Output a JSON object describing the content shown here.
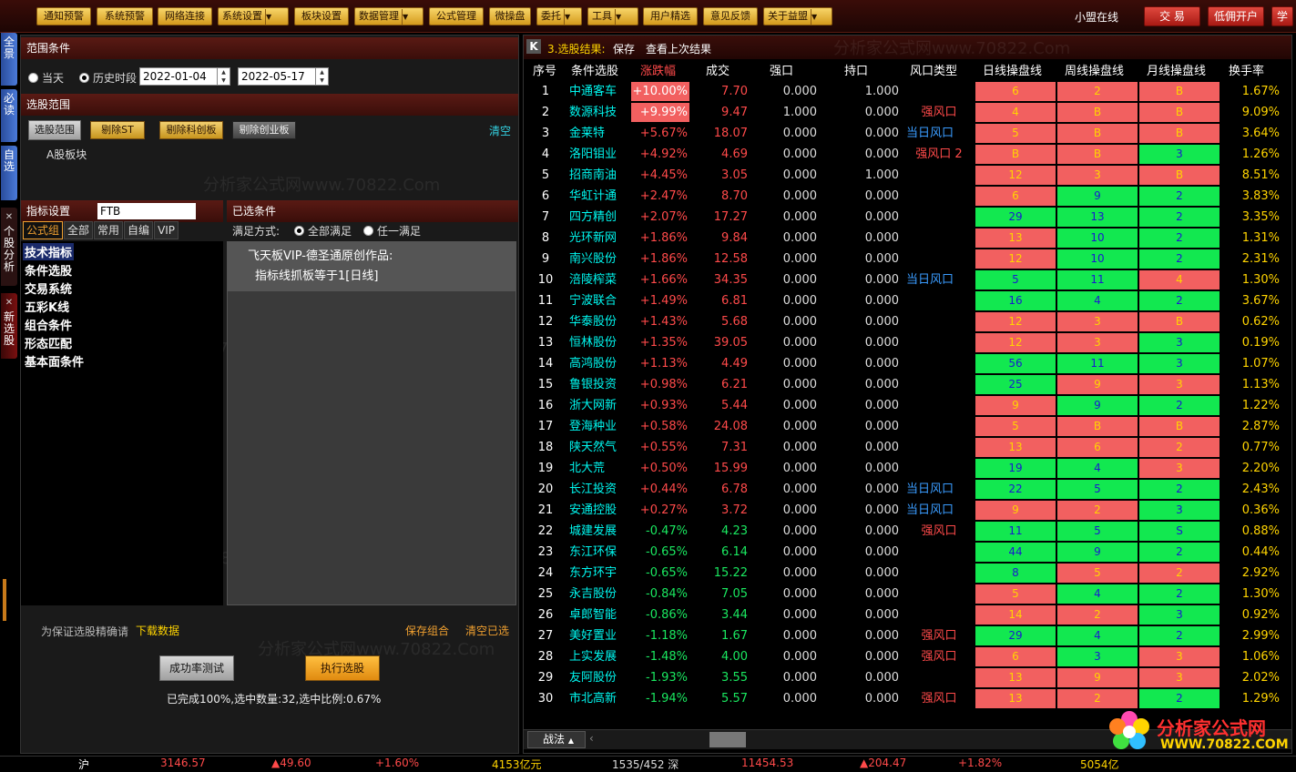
{
  "toolbar": {
    "buttons": [
      "通知预警",
      "系统预警",
      "网络连接",
      "系统设置",
      "板块设置",
      "数据管理",
      "公式管理",
      "微操盘",
      "委托",
      "工具",
      "用户精选",
      "意见反馈",
      "关于益盟"
    ],
    "user_status": "小盟在线",
    "trade_label": "交 易",
    "low_commission_label": "低佣开户",
    "learn_label": "学"
  },
  "side_tabs": [
    "全景",
    "必读",
    "自选",
    "个股分析",
    "新选股"
  ],
  "range": {
    "header": "范围条件",
    "today_label": "当天",
    "history_label": "历史时段",
    "start_date": "2022-01-04",
    "end_date": "2022-05-17"
  },
  "scope": {
    "header": "选股范围",
    "select_scope_btn": "选股范围",
    "remove_st_btn": "剔除ST",
    "remove_star_btn": "剔除科创板",
    "remove_gem_btn": "剔除创业板",
    "clear_link": "清空",
    "block_label": "A股板块"
  },
  "indicator": {
    "header": "指标设置",
    "input_value": "FTB",
    "tabs": [
      "公式组",
      "全部",
      "常用",
      "自编",
      "VIP"
    ],
    "tree_items": [
      "技术指标",
      "条件选股",
      "交易系统",
      "五彩K线",
      "组合条件",
      "形态匹配",
      "基本面条件"
    ]
  },
  "selected": {
    "header": "已选条件",
    "mode_label": "满足方式:",
    "all_label": "全部满足",
    "any_label": "任一满足",
    "line1": "飞天板VIP-德圣通原创作品:",
    "line2": "指标线抓板等于1[日线]"
  },
  "bottom": {
    "notice": "为保证选股精确请",
    "download_link": "下载数据",
    "save_link": "保存组合",
    "clear_selected_link": "清空已选",
    "test_btn": "成功率测试",
    "run_btn": "执行选股",
    "result_text": "已完成100%,选中数量:32,选中比例:0.67%"
  },
  "results": {
    "title": "3.选股结果:",
    "save": "保存",
    "view_last": "查看上次结果",
    "columns": [
      "序号",
      "条件选股",
      "涨跌幅",
      "成交",
      "强口",
      "持口",
      "风口类型",
      "日线操盘线",
      "周线操盘线",
      "月线操盘线",
      "换手率"
    ],
    "rows": [
      {
        "no": "1",
        "name": "中通客车",
        "chg": "+10.00%",
        "vol": "7.70",
        "q": "0.000",
        "c": "1.000",
        "risk": "",
        "d": "6",
        "w": "2",
        "m": "B",
        "dc": "r",
        "wc": "r",
        "mc": "r",
        "turn": "1.67%"
      },
      {
        "no": "2",
        "name": "数源科技",
        "chg": "+9.99%",
        "vol": "9.47",
        "q": "1.000",
        "c": "0.000",
        "risk": "强风口",
        "d": "4",
        "w": "B",
        "m": "B",
        "dc": "r",
        "wc": "r",
        "mc": "r",
        "turn": "9.09%"
      },
      {
        "no": "3",
        "name": "金莱特",
        "chg": "+5.67%",
        "vol": "18.07",
        "q": "0.000",
        "c": "0.000",
        "risk": "当日风口",
        "d": "5",
        "w": "B",
        "m": "B",
        "dc": "r",
        "wc": "r",
        "mc": "r",
        "turn": "3.64%"
      },
      {
        "no": "4",
        "name": "洛阳钼业",
        "chg": "+4.92%",
        "vol": "4.69",
        "q": "0.000",
        "c": "0.000",
        "risk": "强风口 2",
        "d": "B",
        "w": "B",
        "m": "3",
        "dc": "r",
        "wc": "r",
        "mc": "g",
        "turn": "1.26%"
      },
      {
        "no": "5",
        "name": "招商南油",
        "chg": "+4.45%",
        "vol": "3.05",
        "q": "0.000",
        "c": "1.000",
        "risk": "",
        "d": "12",
        "w": "3",
        "m": "B",
        "dc": "r",
        "wc": "r",
        "mc": "r",
        "turn": "8.51%"
      },
      {
        "no": "6",
        "name": "华虹计通",
        "chg": "+2.47%",
        "vol": "8.70",
        "q": "0.000",
        "c": "0.000",
        "risk": "",
        "d": "6",
        "w": "9",
        "m": "2",
        "dc": "r",
        "wc": "g",
        "mc": "g",
        "turn": "3.83%"
      },
      {
        "no": "7",
        "name": "四方精创",
        "chg": "+2.07%",
        "vol": "17.27",
        "q": "0.000",
        "c": "0.000",
        "risk": "",
        "d": "29",
        "w": "13",
        "m": "2",
        "dc": "g",
        "wc": "g",
        "mc": "g",
        "turn": "3.35%"
      },
      {
        "no": "8",
        "name": "光环新网",
        "chg": "+1.86%",
        "vol": "9.84",
        "q": "0.000",
        "c": "0.000",
        "risk": "",
        "d": "13",
        "w": "10",
        "m": "2",
        "dc": "r",
        "wc": "g",
        "mc": "g",
        "turn": "1.31%"
      },
      {
        "no": "9",
        "name": "南兴股份",
        "chg": "+1.86%",
        "vol": "12.58",
        "q": "0.000",
        "c": "0.000",
        "risk": "",
        "d": "12",
        "w": "10",
        "m": "2",
        "dc": "r",
        "wc": "g",
        "mc": "g",
        "turn": "2.31%"
      },
      {
        "no": "10",
        "name": "涪陵榨菜",
        "chg": "+1.66%",
        "vol": "34.35",
        "q": "0.000",
        "c": "0.000",
        "risk": "当日风口",
        "d": "5",
        "w": "11",
        "m": "4",
        "dc": "g",
        "wc": "g",
        "mc": "r",
        "turn": "1.30%"
      },
      {
        "no": "11",
        "name": "宁波联合",
        "chg": "+1.49%",
        "vol": "6.81",
        "q": "0.000",
        "c": "0.000",
        "risk": "",
        "d": "16",
        "w": "4",
        "m": "2",
        "dc": "g",
        "wc": "g",
        "mc": "g",
        "turn": "3.67%"
      },
      {
        "no": "12",
        "name": "华泰股份",
        "chg": "+1.43%",
        "vol": "5.68",
        "q": "0.000",
        "c": "0.000",
        "risk": "",
        "d": "12",
        "w": "3",
        "m": "B",
        "dc": "r",
        "wc": "r",
        "mc": "r",
        "turn": "0.62%"
      },
      {
        "no": "13",
        "name": "恒林股份",
        "chg": "+1.35%",
        "vol": "39.05",
        "q": "0.000",
        "c": "0.000",
        "risk": "",
        "d": "12",
        "w": "3",
        "m": "3",
        "dc": "r",
        "wc": "r",
        "mc": "g",
        "turn": "0.19%"
      },
      {
        "no": "14",
        "name": "高鸿股份",
        "chg": "+1.13%",
        "vol": "4.49",
        "q": "0.000",
        "c": "0.000",
        "risk": "",
        "d": "56",
        "w": "11",
        "m": "3",
        "dc": "g",
        "wc": "g",
        "mc": "g",
        "turn": "1.07%"
      },
      {
        "no": "15",
        "name": "鲁银投资",
        "chg": "+0.98%",
        "vol": "6.21",
        "q": "0.000",
        "c": "0.000",
        "risk": "",
        "d": "25",
        "w": "9",
        "m": "3",
        "dc": "g",
        "wc": "r",
        "mc": "r",
        "turn": "1.13%"
      },
      {
        "no": "16",
        "name": "浙大网新",
        "chg": "+0.93%",
        "vol": "5.44",
        "q": "0.000",
        "c": "0.000",
        "risk": "",
        "d": "9",
        "w": "9",
        "m": "2",
        "dc": "r",
        "wc": "g",
        "mc": "g",
        "turn": "1.22%"
      },
      {
        "no": "17",
        "name": "登海种业",
        "chg": "+0.58%",
        "vol": "24.08",
        "q": "0.000",
        "c": "0.000",
        "risk": "",
        "d": "5",
        "w": "B",
        "m": "B",
        "dc": "r",
        "wc": "r",
        "mc": "r",
        "turn": "2.87%"
      },
      {
        "no": "18",
        "name": "陕天然气",
        "chg": "+0.55%",
        "vol": "7.31",
        "q": "0.000",
        "c": "0.000",
        "risk": "",
        "d": "13",
        "w": "6",
        "m": "2",
        "dc": "r",
        "wc": "r",
        "mc": "r",
        "turn": "0.77%"
      },
      {
        "no": "19",
        "name": "北大荒",
        "chg": "+0.50%",
        "vol": "15.99",
        "q": "0.000",
        "c": "0.000",
        "risk": "",
        "d": "19",
        "w": "4",
        "m": "3",
        "dc": "g",
        "wc": "g",
        "mc": "r",
        "turn": "2.20%"
      },
      {
        "no": "20",
        "name": "长江投资",
        "chg": "+0.44%",
        "vol": "6.78",
        "q": "0.000",
        "c": "0.000",
        "risk": "当日风口",
        "d": "22",
        "w": "5",
        "m": "2",
        "dc": "g",
        "wc": "g",
        "mc": "g",
        "turn": "2.43%"
      },
      {
        "no": "21",
        "name": "安通控股",
        "chg": "+0.27%",
        "vol": "3.72",
        "q": "0.000",
        "c": "0.000",
        "risk": "当日风口",
        "d": "9",
        "w": "2",
        "m": "3",
        "dc": "r",
        "wc": "r",
        "mc": "g",
        "turn": "0.36%"
      },
      {
        "no": "22",
        "name": "城建发展",
        "chg": "-0.47%",
        "vol": "4.23",
        "q": "0.000",
        "c": "0.000",
        "risk": "强风口",
        "d": "11",
        "w": "5",
        "m": "S",
        "dc": "g",
        "wc": "g",
        "mc": "g",
        "turn": "0.88%"
      },
      {
        "no": "23",
        "name": "东江环保",
        "chg": "-0.65%",
        "vol": "6.14",
        "q": "0.000",
        "c": "0.000",
        "risk": "",
        "d": "44",
        "w": "9",
        "m": "2",
        "dc": "g",
        "wc": "g",
        "mc": "g",
        "turn": "0.44%"
      },
      {
        "no": "24",
        "name": "东方环宇",
        "chg": "-0.65%",
        "vol": "15.22",
        "q": "0.000",
        "c": "0.000",
        "risk": "",
        "d": "8",
        "w": "5",
        "m": "2",
        "dc": "g",
        "wc": "r",
        "mc": "r",
        "turn": "2.92%"
      },
      {
        "no": "25",
        "name": "永吉股份",
        "chg": "-0.84%",
        "vol": "7.05",
        "q": "0.000",
        "c": "0.000",
        "risk": "",
        "d": "5",
        "w": "4",
        "m": "2",
        "dc": "r",
        "wc": "g",
        "mc": "g",
        "turn": "1.30%"
      },
      {
        "no": "26",
        "name": "卓郎智能",
        "chg": "-0.86%",
        "vol": "3.44",
        "q": "0.000",
        "c": "0.000",
        "risk": "",
        "d": "14",
        "w": "2",
        "m": "3",
        "dc": "r",
        "wc": "r",
        "mc": "g",
        "turn": "0.92%"
      },
      {
        "no": "27",
        "name": "美好置业",
        "chg": "-1.18%",
        "vol": "1.67",
        "q": "0.000",
        "c": "0.000",
        "risk": "强风口",
        "d": "29",
        "w": "4",
        "m": "2",
        "dc": "g",
        "wc": "g",
        "mc": "g",
        "turn": "2.99%"
      },
      {
        "no": "28",
        "name": "上实发展",
        "chg": "-1.48%",
        "vol": "4.00",
        "q": "0.000",
        "c": "0.000",
        "risk": "强风口",
        "d": "6",
        "w": "3",
        "m": "3",
        "dc": "r",
        "wc": "g",
        "mc": "r",
        "turn": "1.06%"
      },
      {
        "no": "29",
        "name": "友阿股份",
        "chg": "-1.93%",
        "vol": "3.55",
        "q": "0.000",
        "c": "0.000",
        "risk": "",
        "d": "13",
        "w": "9",
        "m": "3",
        "dc": "r",
        "wc": "r",
        "mc": "r",
        "turn": "2.02%"
      },
      {
        "no": "30",
        "name": "市北高新",
        "chg": "-1.94%",
        "vol": "5.57",
        "q": "0.000",
        "c": "0.000",
        "risk": "强风口",
        "d": "13",
        "w": "2",
        "m": "2",
        "dc": "r",
        "wc": "r",
        "mc": "g",
        "turn": "1.29%"
      }
    ],
    "tab_label": "战法"
  },
  "statusbar": [
    "沪",
    "3146.57",
    "▲49.60",
    "+1.60%",
    "4153亿元",
    "1535/452 深",
    "11454.53",
    "▲204.47",
    "+1.82%",
    "5054亿"
  ],
  "watermark": "分析家公式网www.70822.Com",
  "logo": {
    "cn": "分析家公式网",
    "url": "WWW.70822.COM"
  },
  "colors": {
    "up": "#ff4a4a",
    "down": "#1ae860",
    "cyan": "#00f8f0",
    "gold": "#ffd400",
    "risk_red": "#ff4a4a",
    "risk_blue": "#3a9cff"
  }
}
